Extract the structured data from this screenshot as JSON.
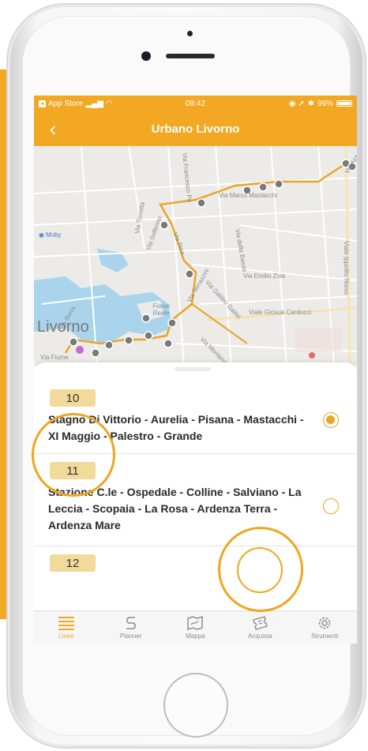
{
  "status_bar": {
    "carrier": "App Store",
    "time": "09:42",
    "battery": "99%"
  },
  "navbar": {
    "title": "Urbano Livorno",
    "back_icon": "chevron-left-icon"
  },
  "map": {
    "city": "Livorno",
    "poi": "Moby",
    "streets": [
      "Via Marco Mastacchi",
      "Via Francesco Pe",
      "Via Torretta",
      "Via Solferino",
      "Via Pisa",
      "Via della Bassa",
      "Via Emilio Zola",
      "Viale Ippolito Nievo",
      "Via Galileo Galilei",
      "Via Terrazzini",
      "Via Montana",
      "Viale Giosuè Carducci",
      "Via Fiume",
      "Via Borra"
    ],
    "area_label": "Fosse Reale",
    "top_right_label": "Via Azz",
    "route_color": "#E8A52A"
  },
  "routes": [
    {
      "number": "10",
      "stops": "Stagno Di Vittorio - Aurelia - Pisana - Mastacchi - XI Maggio - Palestro - Grande",
      "selected": true
    },
    {
      "number": "11",
      "stops": "Stazione C.le - Ospedale - Colline - Salviano - La Leccia - Scopaia - La Rosa - Ardenza Terra - Ardenza Mare",
      "selected": false
    },
    {
      "number": "12",
      "stops": "",
      "selected": false
    }
  ],
  "tabs": [
    {
      "label": "Linee",
      "icon": "list-icon",
      "active": true
    },
    {
      "label": "Planner",
      "icon": "route-s-icon",
      "active": false
    },
    {
      "label": "Mappa",
      "icon": "map-icon",
      "active": false
    },
    {
      "label": "Acquista",
      "icon": "ticket-icon",
      "active": false
    },
    {
      "label": "Strumenti",
      "icon": "gear-icon",
      "active": false
    }
  ],
  "colors": {
    "accent": "#F2A823",
    "badge": "#F1DA9A",
    "highlight": "#F0A620"
  }
}
